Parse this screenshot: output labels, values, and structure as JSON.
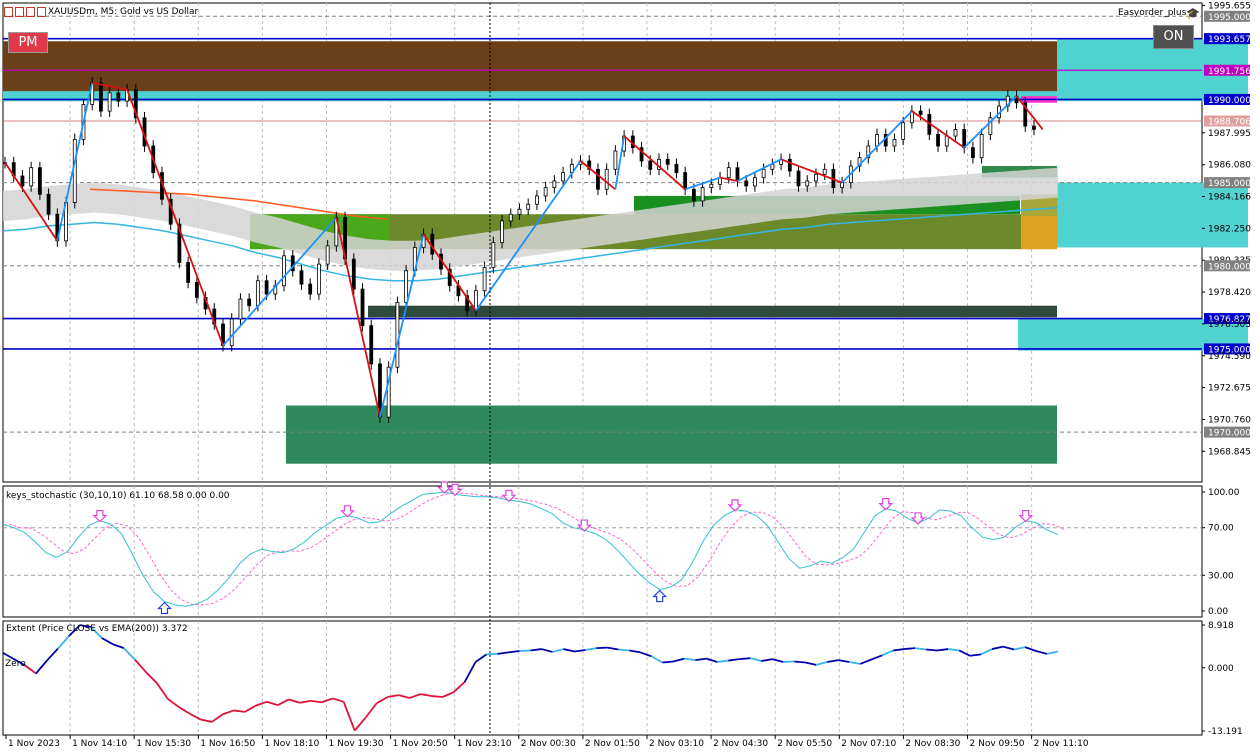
{
  "header": {
    "symbol_title": "XAUUSDm, M5:  Gold vs US Dollar",
    "ea_name": "Easyorder_plus",
    "pm_badge": "PM",
    "on_badge": "ON"
  },
  "colors": {
    "brown_zone": "#6b4019",
    "cyan_zone": "#4fd2d0",
    "green_zone": "#4aa81a",
    "olive_zone": "#6d8a2a",
    "dark_green_zone": "#2e8a5a",
    "darkslate_zone": "#2e4a3a",
    "zigzag_up": "#1e90ff",
    "zigzag_down": "#d81010",
    "ema": "#33b5e5",
    "ema_slow": "#ff5a1f",
    "blue_level": "#0000cc",
    "magenta_level": "#c000c0",
    "stoch_main": "#33c0d0",
    "stoch_signal": "#ff66cc",
    "extent_pos": "#0000aa",
    "extent_neg": "#e0103a"
  },
  "chart_data": [
    {
      "type": "line",
      "name": "price",
      "title": "XAUUSDm, M5:  Gold vs US Dollar",
      "ylim": [
        1967.0,
        1995.8
      ],
      "price_ticks": [
        "1995.655",
        "1995.000",
        "1993.657",
        "1991.756",
        "1990.000",
        "1988.706",
        "1987.995",
        "1986.080",
        "1985.000",
        "1984.166",
        "1982.250",
        "1980.335",
        "1980.000",
        "1978.420",
        "1976.827",
        "1976.505",
        "1975.000",
        "1974.590",
        "1972.675",
        "1970.760",
        "1970.000",
        "1968.845"
      ],
      "x_ticks": [
        "1 Nov 2023",
        "1 Nov 14:10",
        "1 Nov 15:30",
        "1 Nov 16:50",
        "1 Nov 18:10",
        "1 Nov 19:30",
        "1 Nov 20:50",
        "1 Nov 23:10",
        "2 Nov 00:30",
        "2 Nov 01:50",
        "2 Nov 03:10",
        "2 Nov 04:30",
        "2 Nov 05:50",
        "2 Nov 07:10",
        "2 Nov 08:30",
        "2 Nov 09:50",
        "2 Nov 11:10"
      ],
      "close_series": [
        1986.2,
        1985.4,
        1984.8,
        1985.9,
        1984.3,
        1983.1,
        1981.5,
        1983.8,
        1987.6,
        1989.7,
        1991.0,
        1989.3,
        1990.4,
        1989.9,
        1990.6,
        1988.9,
        1987.2,
        1985.6,
        1984.0,
        1982.5,
        1980.2,
        1979.0,
        1978.1,
        1977.4,
        1976.5,
        1975.2,
        1976.8,
        1978.0,
        1977.6,
        1979.1,
        1978.3,
        1978.8,
        1980.6,
        1979.7,
        1978.9,
        1978.3,
        1980.1,
        1981.2,
        1982.9,
        1980.4,
        1978.6,
        1976.4,
        1974.1,
        1970.9,
        1973.9,
        1977.8,
        1979.7,
        1981.1,
        1981.9,
        1980.7,
        1979.8,
        1978.8,
        1978.2,
        1977.3,
        1978.5,
        1979.9,
        1981.4,
        1982.7,
        1983.1,
        1983.4,
        1983.7,
        1984.2,
        1984.7,
        1985.1,
        1985.6,
        1986.1,
        1986.3,
        1985.8,
        1984.6,
        1985.8,
        1986.9,
        1987.8,
        1987.1,
        1986.3,
        1985.8,
        1986.4,
        1986.1,
        1985.6,
        1984.6,
        1983.9,
        1984.7,
        1984.9,
        1985.3,
        1985.9,
        1985.1,
        1984.8,
        1985.3,
        1985.8,
        1986.1,
        1986.4,
        1985.7,
        1984.8,
        1985.1,
        1985.5,
        1985.8,
        1984.7,
        1985.0,
        1986.0,
        1986.5,
        1987.2,
        1987.9,
        1987.2,
        1987.6,
        1988.6,
        1989.3,
        1989.1,
        1987.9,
        1987.2,
        1987.8,
        1988.2,
        1987.1,
        1986.5,
        1987.9,
        1988.9,
        1989.6,
        1990.2,
        1989.8,
        1988.4,
        1988.2
      ],
      "zigzag": [
        [
          0,
          1986.2
        ],
        [
          6,
          1981.5
        ],
        [
          10,
          1991.0
        ],
        [
          14,
          1990.6
        ],
        [
          25,
          1975.2
        ],
        [
          38,
          1982.9
        ],
        [
          43,
          1970.9
        ],
        [
          48,
          1981.9
        ],
        [
          54,
          1977.3
        ],
        [
          66,
          1986.3
        ],
        [
          70,
          1984.6
        ],
        [
          71,
          1987.8
        ],
        [
          78,
          1984.6
        ],
        [
          82,
          1985.3
        ],
        [
          84,
          1985.1
        ],
        [
          89,
          1986.4
        ],
        [
          96,
          1985.0
        ],
        [
          104,
          1989.3
        ],
        [
          110,
          1987.1
        ],
        [
          116,
          1990.2
        ],
        [
          119,
          1988.2
        ]
      ],
      "ema_fast": [
        1983.6,
        1983.7,
        1983.9,
        1984.0,
        1984.1,
        1984.0,
        1983.8,
        1983.6,
        1983.3,
        1983.0,
        1982.7,
        1982.3,
        1982.0,
        1981.6,
        1981.2,
        1980.9,
        1980.7,
        1980.6,
        1980.6,
        1980.7,
        1980.9,
        1981.1,
        1981.3,
        1981.5,
        1981.7,
        1981.9,
        1982.1,
        1982.3,
        1982.5,
        1982.7,
        1982.9,
        1983.1,
        1983.3,
        1983.5,
        1983.7,
        1983.8,
        1984.0,
        1984.1,
        1984.2,
        1984.3,
        1984.4,
        1984.5,
        1984.6,
        1984.7,
        1984.8,
        1984.9,
        1985.0
      ],
      "ema_slow": [
        1984.6,
        1984.5,
        1984.4,
        1984.3,
        1984.1,
        1983.9,
        1983.6,
        1983.3,
        1983.0,
        1982.8
      ],
      "levels": [
        {
          "label": "1995.000",
          "value": 1995.0,
          "style": "dotted"
        },
        {
          "label": "1993.657",
          "value": 1993.657,
          "style": "blue"
        },
        {
          "label": "1991.756",
          "value": 1991.756,
          "style": "magenta"
        },
        {
          "label": "1990.000",
          "value": 1990.0,
          "style": "blue"
        },
        {
          "label": "1988.706",
          "value": 1988.706,
          "style": "red"
        },
        {
          "label": "1985.000",
          "value": 1985.0,
          "style": "dotted"
        },
        {
          "label": "1980.000",
          "value": 1980.0,
          "style": "dotted"
        },
        {
          "label": "1976.827",
          "value": 1976.827,
          "style": "blue"
        },
        {
          "label": "1975.000",
          "value": 1975.0,
          "style": "blue"
        },
        {
          "label": "1970.000",
          "value": 1970.0,
          "style": "dotted"
        }
      ]
    },
    {
      "type": "line",
      "name": "keys_stochastic",
      "label": "keys_stochastic (30,10,10) 61.10 68.58 0.00 0.00",
      "ylim": [
        0,
        100
      ],
      "ticks": [
        "100.00",
        "70.00",
        "30.00",
        "0.00"
      ],
      "main": [
        73,
        70,
        66,
        58,
        49,
        45,
        50,
        62,
        72,
        76,
        73,
        65,
        48,
        30,
        16,
        8,
        5,
        4,
        6,
        10,
        18,
        28,
        40,
        48,
        52,
        50,
        49,
        52,
        58,
        66,
        72,
        78,
        80,
        78,
        74,
        75,
        82,
        88,
        93,
        98,
        99,
        100,
        98,
        97,
        96,
        96,
        95,
        93,
        92,
        90,
        86,
        82,
        74,
        70,
        68,
        65,
        60,
        52,
        42,
        32,
        24,
        18,
        20,
        26,
        40,
        58,
        72,
        80,
        85,
        84,
        80,
        72,
        58,
        44,
        36,
        38,
        42,
        40,
        45,
        52,
        66,
        80,
        86,
        84,
        78,
        74,
        78,
        85,
        84,
        80,
        70,
        62,
        60,
        62,
        70,
        76,
        74,
        68,
        64
      ]
    },
    {
      "type": "line",
      "name": "extent",
      "label": "Extent (Price CLOSE vs EMA(200)) 3.372",
      "ylim": [
        -13.191,
        8.918
      ],
      "ticks": [
        "8.918",
        "0.000",
        "-13.191"
      ],
      "zero_label": "Zero",
      "values": [
        3.1,
        1.8,
        0.5,
        -1.2,
        1.5,
        4.0,
        6.6,
        8.9,
        8.5,
        6.2,
        4.9,
        4.1,
        1.7,
        -0.9,
        -3.2,
        -6.5,
        -8.2,
        -9.6,
        -10.8,
        -11.3,
        -9.7,
        -8.9,
        -9.2,
        -7.9,
        -7.1,
        -7.8,
        -6.6,
        -7.3,
        -6.9,
        -7.2,
        -6.4,
        -7.1,
        -13.1,
        -10.4,
        -7.4,
        -6.1,
        -5.7,
        -6.3,
        -5.5,
        -5.9,
        -6.1,
        -5.1,
        -3.0,
        1.2,
        2.8,
        2.9,
        3.2,
        3.5,
        3.6,
        3.9,
        3.3,
        3.9,
        3.4,
        3.7,
        4.1,
        4.2,
        3.8,
        3.6,
        3.2,
        2.4,
        1.1,
        1.3,
        1.9,
        1.6,
        1.9,
        1.2,
        1.5,
        1.8,
        2.0,
        1.4,
        1.8,
        1.2,
        1.3,
        1.1,
        0.6,
        1.2,
        1.6,
        1.2,
        0.8,
        1.7,
        2.6,
        3.6,
        3.9,
        4.1,
        3.8,
        3.6,
        3.9,
        3.6,
        2.5,
        2.8,
        3.9,
        4.4,
        3.8,
        4.3,
        3.5,
        2.9,
        3.4
      ]
    }
  ]
}
